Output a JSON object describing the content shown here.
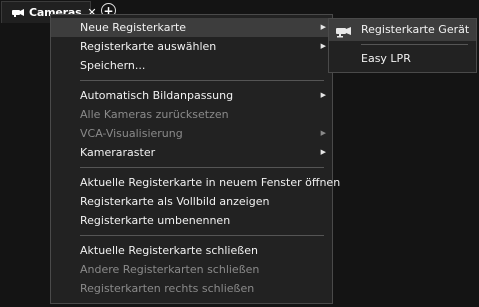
{
  "tab": {
    "label": "Cameras",
    "close": "✕",
    "add": "+"
  },
  "menu": {
    "items": [
      {
        "label": "Neue Registerkarte",
        "submenu": true,
        "disabled": false
      },
      {
        "label": "Registerkarte auswählen",
        "submenu": true,
        "disabled": false
      },
      {
        "label": "Speichern...",
        "submenu": false,
        "disabled": false
      },
      {
        "label": "Automatisch Bildanpassung",
        "submenu": true,
        "disabled": false
      },
      {
        "label": "Alle Kameras zurücksetzen",
        "submenu": false,
        "disabled": true
      },
      {
        "label": "VCA-Visualisierung",
        "submenu": true,
        "disabled": true
      },
      {
        "label": "Kameraraster",
        "submenu": true,
        "disabled": false
      },
      {
        "label": "Aktuelle Registerkarte in neuem Fenster öffnen",
        "submenu": false,
        "disabled": false
      },
      {
        "label": "Registerkarte als Vollbild anzeigen",
        "submenu": false,
        "disabled": false
      },
      {
        "label": "Registerkarte umbenennen",
        "submenu": false,
        "disabled": false
      },
      {
        "label": "Aktuelle Registerkarte schließen",
        "submenu": false,
        "disabled": false
      },
      {
        "label": "Andere Registerkarten schließen",
        "submenu": false,
        "disabled": true
      },
      {
        "label": "Registerkarten rechts schließen",
        "submenu": false,
        "disabled": true
      }
    ]
  },
  "submenu": {
    "items": [
      {
        "label": "Registerkarte Gerät",
        "icon": "camera-icon"
      },
      {
        "label": "Easy LPR",
        "icon": ""
      }
    ]
  },
  "colors": {
    "background": "#141414",
    "menu_bg": "#222222",
    "highlight": "#3d3d3d",
    "text": "#f2f2f2",
    "disabled_text": "#8a8a8a"
  }
}
